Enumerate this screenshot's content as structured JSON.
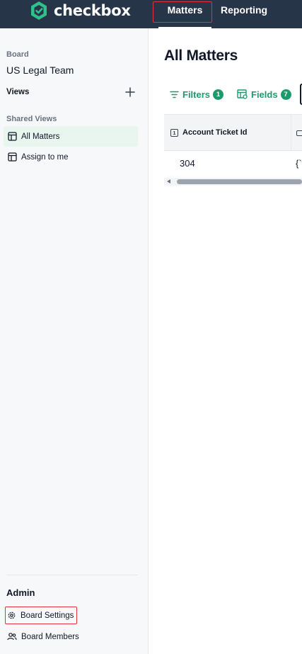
{
  "app": {
    "name": "checkbox"
  },
  "nav": {
    "tabs": [
      {
        "label": "Matters",
        "active": true
      },
      {
        "label": "Reporting",
        "active": false
      }
    ]
  },
  "sidebar": {
    "board_label": "Board",
    "board_name": "US Legal Team",
    "views_label": "Views",
    "shared_views_label": "Shared Views",
    "shared_views": [
      {
        "label": "All Matters",
        "icon": "table-icon",
        "active": true
      },
      {
        "label": "Assign to me",
        "icon": "table-icon",
        "active": false
      }
    ],
    "admin_label": "Admin",
    "admin_items": [
      {
        "label": "Board Settings",
        "icon": "gear-icon"
      },
      {
        "label": "Board Members",
        "icon": "users-icon"
      }
    ]
  },
  "main": {
    "title": "All Matters",
    "toolbar": {
      "filters_label": "Filters",
      "filters_count": "1",
      "fields_label": "Fields",
      "fields_count": "7"
    },
    "table": {
      "columns": [
        {
          "label": "Account Ticket Id",
          "icon": "number-field-icon",
          "icon_glyph": "1"
        },
        {
          "label": "",
          "icon": "text-field-icon"
        }
      ],
      "rows": [
        {
          "account_ticket_id": "304",
          "col2": "{`"
        }
      ]
    }
  },
  "colors": {
    "topbar": "#263548",
    "accent_green": "#1d9a6c",
    "active_view_bg": "#e8f6ef",
    "highlight_red": "#e0333b"
  }
}
